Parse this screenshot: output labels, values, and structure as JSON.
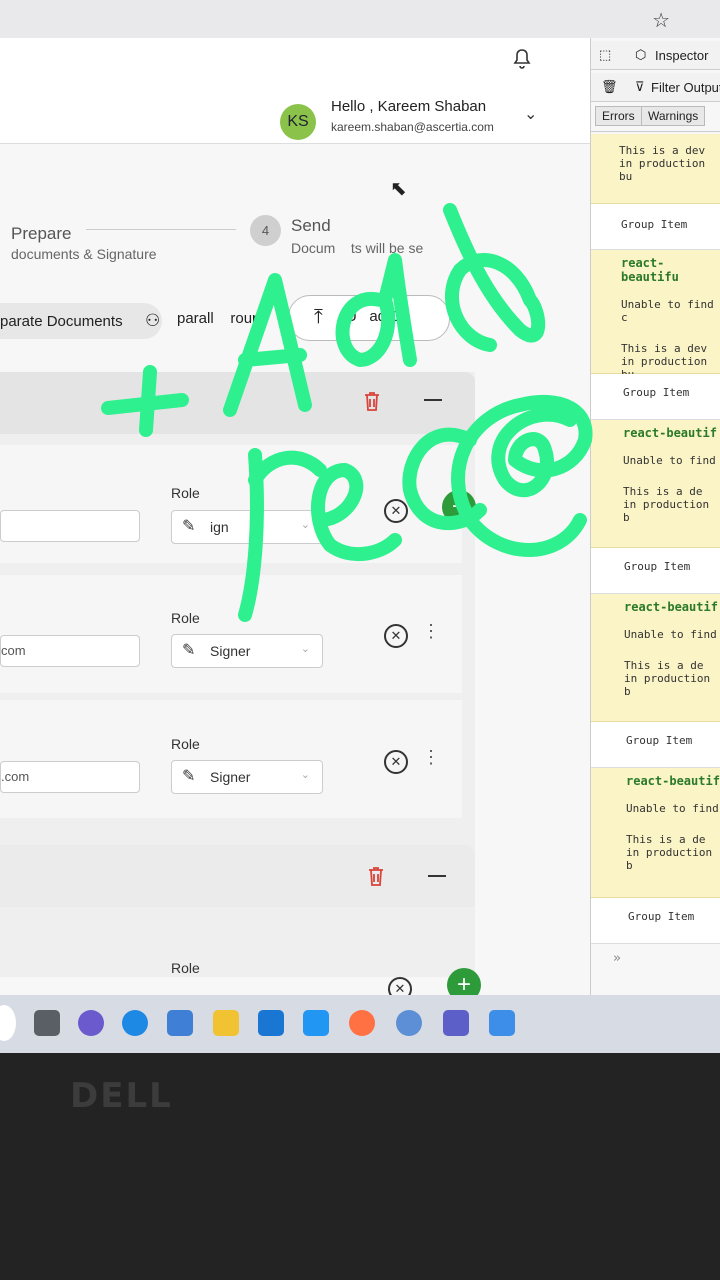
{
  "header": {
    "avatar_initials": "KS",
    "greeting": "Hello , Kareem Shaban",
    "email": "kareem.shaban@ascertia.com"
  },
  "steps": {
    "prepare_title": "Prepare",
    "prepare_sub": "documents & Signature",
    "send_number": "4",
    "send_title": "Send",
    "send_sub": "Docum    ts will be se"
  },
  "tabs": {
    "separate": "parate Documents",
    "parallel": "parall    roup",
    "upload": "U   ad C"
  },
  "rows": [
    {
      "role_label": "Role",
      "email_partial": "",
      "role_value": "ign"
    },
    {
      "role_label": "Role",
      "email_partial": "com",
      "role_value": "Signer"
    },
    {
      "role_label": "Role",
      "email_partial": ".com",
      "role_value": "Signer"
    },
    {
      "role_label": "Role",
      "email_partial": "",
      "role_value": ""
    }
  ],
  "devtools": {
    "inspector": "Inspector",
    "filter": "Filter Output",
    "errors": "Errors",
    "warnings": "Warnings",
    "logs": [
      {
        "head": "",
        "line1": "This is a dev",
        "line2": "in production bu"
      },
      {
        "plain": "Group Item"
      },
      {
        "head": "react-beautifu",
        "line0": "Unable to find c",
        "line1": "This is a dev",
        "line2": "in production bu"
      },
      {
        "plain": "Group Item"
      },
      {
        "head": "react-beautif",
        "line0": "Unable to find",
        "line1": "This is a de",
        "line2": "in production b"
      },
      {
        "plain": "Group Item"
      },
      {
        "head": "react-beautif",
        "line0": "Unable to find",
        "line1": "This is a de",
        "line2": "in production b"
      },
      {
        "plain": "Group Item"
      },
      {
        "head": "react-beautif",
        "line0": "Unable to find",
        "line1": "This is a de",
        "line2": "in production b"
      },
      {
        "plain": "Group Item"
      }
    ]
  },
  "annotation": {
    "line1": "+ Add",
    "line2": "rec@"
  },
  "monitor": {
    "brand": "DELL"
  },
  "colors": {
    "avatar": "#8bc34a",
    "add_green": "#2e9b3a",
    "scribble": "#2ef08f",
    "trash_red": "#d9443a"
  }
}
